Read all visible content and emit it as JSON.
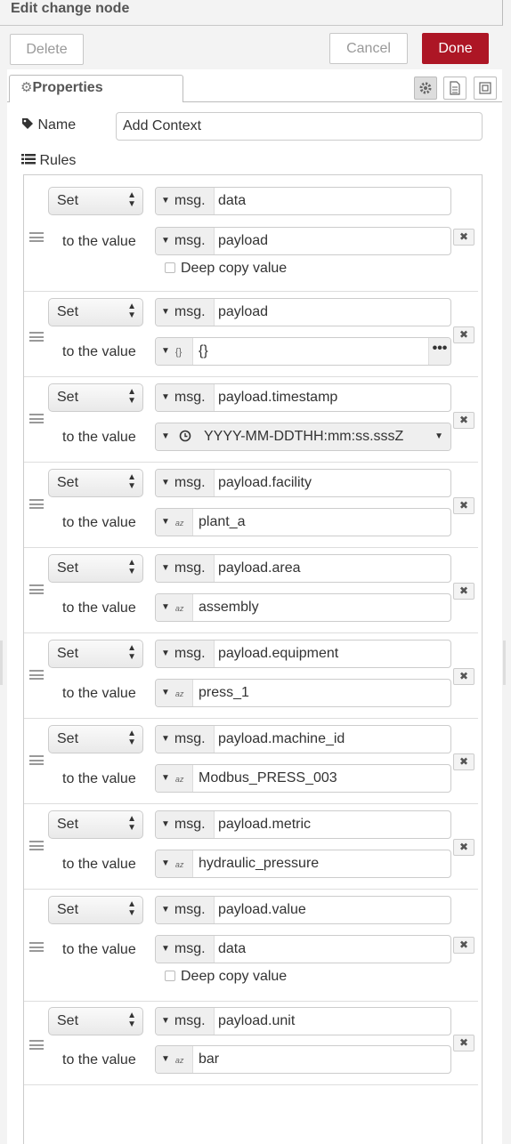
{
  "tray": {
    "title": "Edit change node"
  },
  "toolbar": {
    "delete_label": "Delete",
    "cancel_label": "Cancel",
    "done_label": "Done"
  },
  "tabs": [
    {
      "label": "Properties",
      "icon": "gear-icon"
    }
  ],
  "tab_buttons": [
    "gear-icon",
    "document-icon",
    "frame-icon"
  ],
  "form": {
    "name_label": "Name",
    "name_value": "Add Context",
    "rules_label": "Rules"
  },
  "rules": [
    {
      "action": "Set",
      "prop_prefix": "msg.",
      "prop": "data",
      "to_label": "to the value",
      "value_type": "msg",
      "value_prefix": "msg.",
      "value": "payload",
      "deep_copy": "Deep copy value"
    },
    {
      "action": "Set",
      "prop_prefix": "msg.",
      "prop": "payload",
      "to_label": "to the value",
      "value_type": "json",
      "value_icon": "{}",
      "value": "{}",
      "expand": "•••"
    },
    {
      "action": "Set",
      "prop_prefix": "msg.",
      "prop": "payload.timestamp",
      "to_label": "to the value",
      "value_type": "date",
      "value": "YYYY-MM-DDTHH:mm:ss.sssZ"
    },
    {
      "action": "Set",
      "prop_prefix": "msg.",
      "prop": "payload.facility",
      "to_label": "to the value",
      "value_type": "str",
      "value_icon": "az",
      "value": "plant_a"
    },
    {
      "action": "Set",
      "prop_prefix": "msg.",
      "prop": "payload.area",
      "to_label": "to the value",
      "value_type": "str",
      "value_icon": "az",
      "value": "assembly"
    },
    {
      "action": "Set",
      "prop_prefix": "msg.",
      "prop": "payload.equipment",
      "to_label": "to the value",
      "value_type": "str",
      "value_icon": "az",
      "value": "press_1"
    },
    {
      "action": "Set",
      "prop_prefix": "msg.",
      "prop": "payload.machine_id",
      "to_label": "to the value",
      "value_type": "str",
      "value_icon": "az",
      "value": "Modbus_PRESS_003"
    },
    {
      "action": "Set",
      "prop_prefix": "msg.",
      "prop": "payload.metric",
      "to_label": "to the value",
      "value_type": "str",
      "value_icon": "az",
      "value": "hydraulic_pressure"
    },
    {
      "action": "Set",
      "prop_prefix": "msg.",
      "prop": "payload.value",
      "to_label": "to the value",
      "value_type": "msg",
      "value_prefix": "msg.",
      "value": "data",
      "deep_copy": "Deep copy value"
    },
    {
      "action": "Set",
      "prop_prefix": "msg.",
      "prop": "payload.unit",
      "to_label": "to the value",
      "value_type": "str",
      "value_icon": "az",
      "value": "bar"
    }
  ]
}
